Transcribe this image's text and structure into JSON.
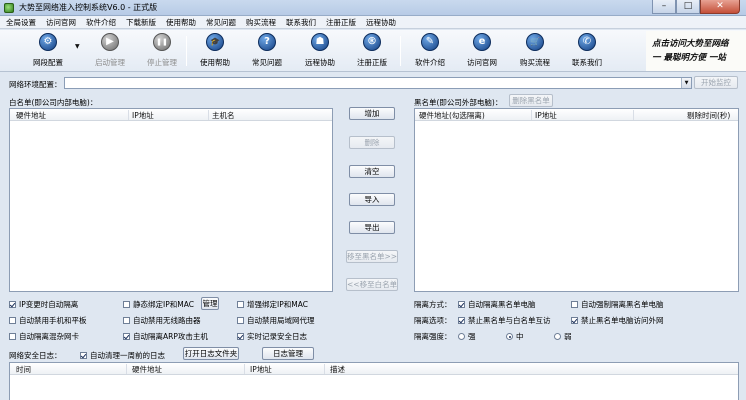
{
  "window": {
    "title": "大势至网络准入控制系统V6.0 - 正式版",
    "min": "–",
    "max": "□",
    "close": "✕"
  },
  "menu": [
    "全局设置",
    "访问官网",
    "软件介绍",
    "下载新版",
    "使用帮助",
    "常见问题",
    "购买流程",
    "联系我们",
    "注册正版",
    "远程协助"
  ],
  "toolbar": [
    {
      "label": "网段配置",
      "icon": "gear-icon",
      "glyph": "⚙",
      "enabled": true
    },
    {
      "label": "启动管理",
      "icon": "play-icon",
      "glyph": "▶",
      "enabled": false
    },
    {
      "label": "停止管理",
      "icon": "pause-icon",
      "glyph": "❚❚",
      "enabled": false
    },
    {
      "label": "使用帮助",
      "icon": "graduation-cap-icon",
      "glyph": "🎓",
      "enabled": true
    },
    {
      "label": "常见问题",
      "icon": "question-icon",
      "glyph": "?",
      "enabled": true
    },
    {
      "label": "远程协助",
      "icon": "remote-assist-icon",
      "glyph": "☗",
      "enabled": true
    },
    {
      "label": "注册正版",
      "icon": "registered-icon",
      "glyph": "®",
      "enabled": true
    },
    {
      "label": "软件介绍",
      "icon": "intro-icon",
      "glyph": "✎",
      "enabled": true
    },
    {
      "label": "访问官网",
      "icon": "ie-icon",
      "glyph": "e",
      "enabled": true
    },
    {
      "label": "购买流程",
      "icon": "cart-icon",
      "glyph": "🛒",
      "enabled": true
    },
    {
      "label": "联系我们",
      "icon": "contact-icon",
      "glyph": "✆",
      "enabled": true
    }
  ],
  "banner": {
    "line1": "点击访问大势至网络",
    "line2": "一 最聪明方便 一站"
  },
  "network_env": {
    "label": "网络环境配置：",
    "value": "",
    "start_button": "开始监控"
  },
  "whitelist": {
    "label": "白名单(即公司内部电脑)：",
    "columns": [
      "硬件地址",
      "IP地址",
      "主机名"
    ]
  },
  "blacklist": {
    "label": "黑名单(即公司外部电脑)：",
    "delete_button": "删除黑名单",
    "columns": [
      "硬件地址(勾选隔离)",
      "IP地址",
      "剔除时间(秒)"
    ]
  },
  "middle_buttons": {
    "add": "增加",
    "delete": "删除",
    "clear": "清空",
    "import": "导入",
    "export": "导出",
    "move_to_black": "移至黑名单>>",
    "move_to_white": "<<移至白名单"
  },
  "options": {
    "ip_change_isolate": "IP变更时自动隔离",
    "static_bind": "静态绑定IP和MAC",
    "manage_button": "管理",
    "enhanced_bind": "增强绑定IP和MAC",
    "auto_disable_mobile": "自动禁用手机和平板",
    "auto_disable_wifi_router": "自动禁用无线路由器",
    "auto_disable_lan_proxy": "自动禁用局域网代理",
    "auto_isolate_multi_nic": "自动隔离混杂网卡",
    "auto_isolate_arp": "自动隔离ARP攻击主机",
    "realtime_log": "实时记录安全日志"
  },
  "isolation": {
    "mode_label": "隔离方式：",
    "auto_isolate_black": "自动隔离黑名单电脑",
    "auto_force_isolate_black": "自动强制隔离黑名单电脑",
    "opts_label": "隔离选项：",
    "forbid_black_white": "禁止黑名单与白名单互访",
    "forbid_black_internet": "禁止黑名单电脑访问外网",
    "strength_label": "隔离强度：",
    "strong": "强",
    "medium": "中",
    "weak": "弱"
  },
  "log": {
    "label": "网络安全日志：",
    "auto_clear": "自动清理一周前的日志",
    "open_folder_button": "打开日志文件夹",
    "manage_button": "日志管理",
    "columns": [
      "时间",
      "硬件地址",
      "IP地址",
      "描述"
    ]
  },
  "colors": {
    "titlebar": "#c9d9ee",
    "icon_blue": "#1d4f9a",
    "window_bg": "#dfe7f1",
    "close_red": "#c44f38"
  }
}
